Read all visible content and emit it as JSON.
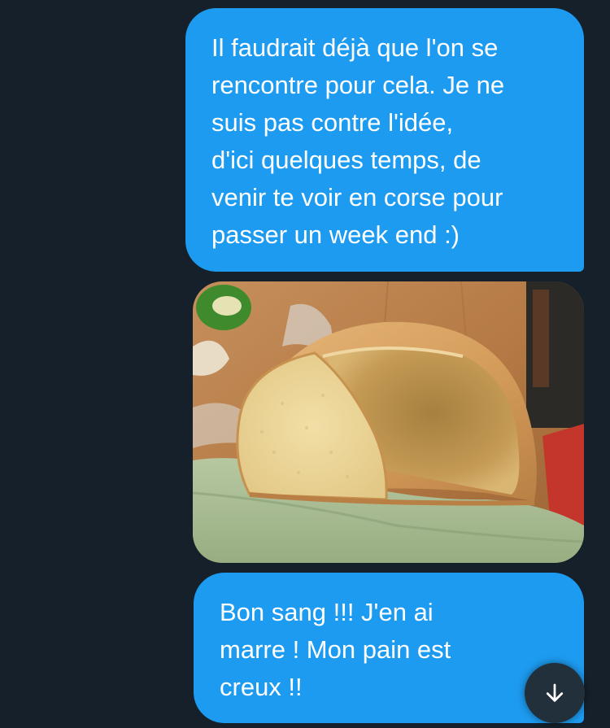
{
  "conversation": {
    "messages": [
      {
        "type": "text",
        "direction": "sent",
        "text": "Il faudrait déjà que l'on se\nrencontre pour cela. Je ne\nsuis pas contre l'idée,\nd'ici quelques temps, de\nvenir te voir en corse pour\npasser un week end :)"
      },
      {
        "type": "image",
        "direction": "sent",
        "subject": "hollow-bread-photo"
      },
      {
        "type": "text",
        "direction": "sent",
        "text": "Bon sang !!! J'en ai\nmarre ! Mon pain est\ncreux !!"
      }
    ]
  },
  "scroll_button": {
    "icon": "arrow-down-icon"
  },
  "colors": {
    "background": "#15202b",
    "bubble": "#1d9bf0",
    "bubble_text": "#ffffff",
    "scroll_button": "#22303c"
  }
}
